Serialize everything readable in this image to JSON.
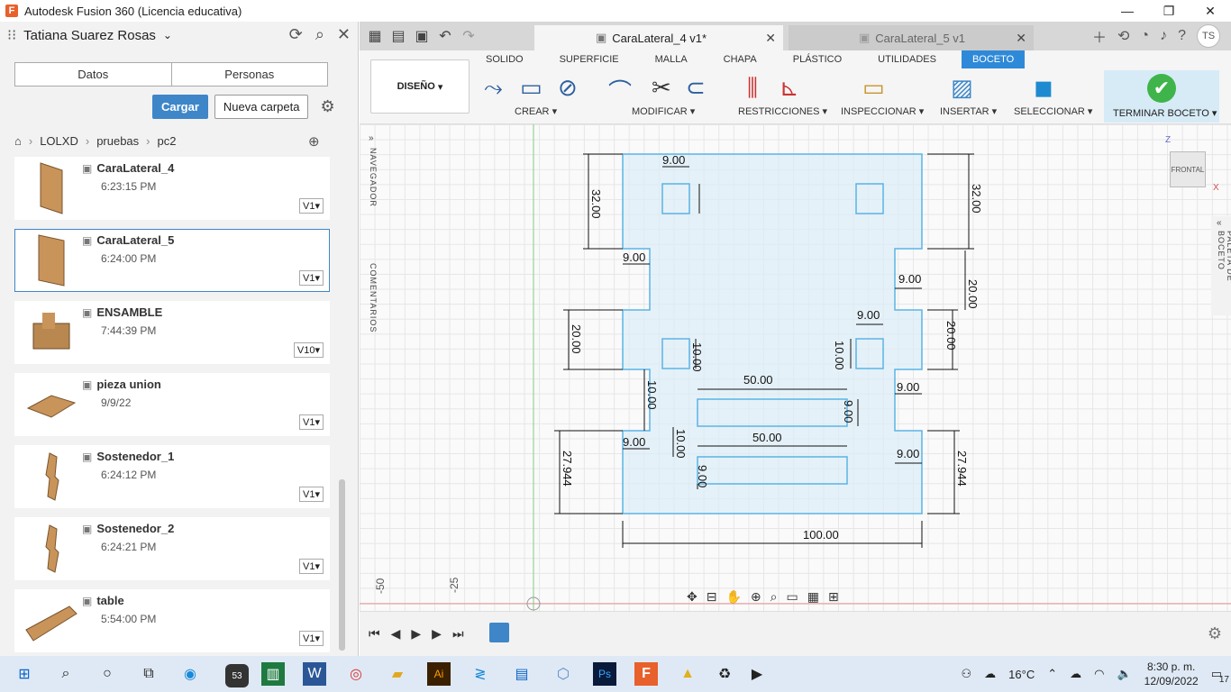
{
  "window": {
    "title": "Autodesk Fusion 360 (Licencia educativa)"
  },
  "left": {
    "user": "Tatiana Suarez Rosas",
    "tabs": [
      "Datos",
      "Personas"
    ],
    "upload": "Cargar",
    "new_folder": "Nueva carpeta",
    "breadcrumb": [
      "LOLXD",
      "pruebas",
      "pc2"
    ],
    "files": [
      {
        "name": "CaraLateral_4",
        "time": "6:23:15 PM",
        "version": "V1"
      },
      {
        "name": "CaraLateral_5",
        "time": "6:24:00 PM",
        "version": "V1"
      },
      {
        "name": "ENSAMBLE",
        "time": "7:44:39 PM",
        "version": "V10"
      },
      {
        "name": "pieza union",
        "time": "9/9/22",
        "version": "V1"
      },
      {
        "name": "Sostenedor_1",
        "time": "6:24:12 PM",
        "version": "V1"
      },
      {
        "name": "Sostenedor_2",
        "time": "6:24:21 PM",
        "version": "V1"
      },
      {
        "name": "table",
        "time": "5:54:00 PM",
        "version": "V1"
      }
    ]
  },
  "doc_tabs": [
    {
      "label": "CaraLateral_4 v1*"
    },
    {
      "label": "CaraLateral_5 v1"
    }
  ],
  "avatar": "TS",
  "ribbon": {
    "workspace": "DISEÑO",
    "tabs": [
      "SOLIDO",
      "SUPERFICIE",
      "MALLA",
      "CHAPA",
      "PLÁSTICO",
      "UTILIDADES",
      "BOCETO"
    ],
    "groups": [
      "CREAR",
      "MODIFICAR",
      "RESTRICCIONES",
      "INSPECCIONAR",
      "INSERTAR",
      "SELECCIONAR",
      "TERMINAR BOCETO"
    ]
  },
  "side": {
    "nav": "NAVEGADOR",
    "comments": "COMENTARIOS",
    "palette": "PALETA DE BOCETO"
  },
  "viewcube": {
    "face": "FRONTAL",
    "z": "Z",
    "x": "X"
  },
  "dimensions": [
    "9.00",
    "32.00",
    "32.00",
    "9.00",
    "20.00",
    "9.00",
    "20.00",
    "20.00",
    "9.00",
    "10.00",
    "10.00",
    "10.00",
    "50.00",
    "9.00",
    "9.00",
    "50.00",
    "10.00",
    "9.00",
    "9.00",
    "27.944",
    "27.944",
    "9.00",
    "100.00"
  ],
  "axis": [
    "-50",
    "-25"
  ],
  "taskbar": {
    "temp": "16°C",
    "time": "8:30 p. m.",
    "date": "12/09/2022",
    "notif": "17",
    "mail_count": "53"
  },
  "colors": {
    "accent": "#2e8ad8",
    "sketch": "#5ab4e5",
    "check": "#3fb44a"
  }
}
